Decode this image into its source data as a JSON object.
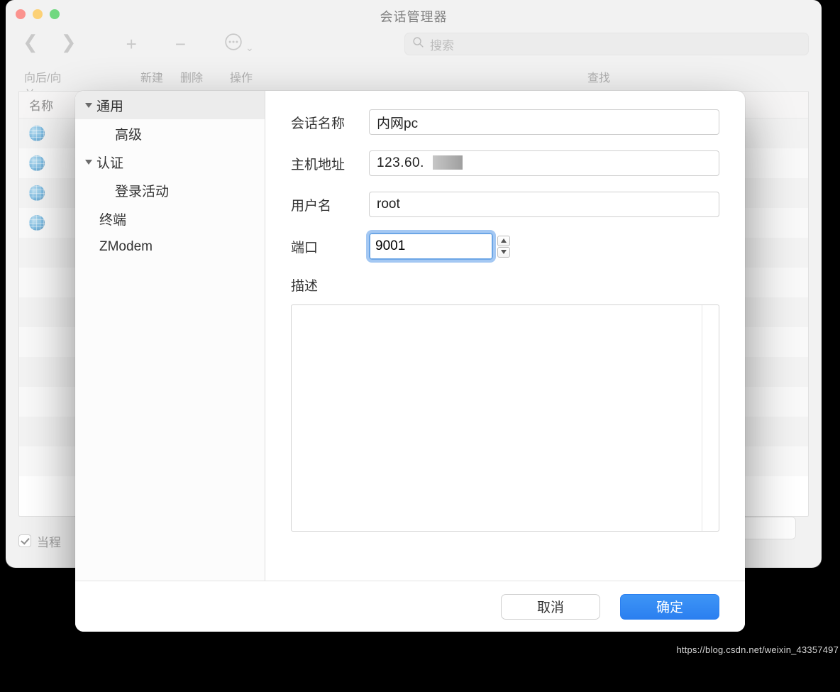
{
  "window": {
    "title": "会话管理器",
    "toolbar": {
      "navLabel": "向后/向前",
      "newLabel": "新建",
      "deleteLabel": "删除",
      "actionLabel": "操作",
      "searchLabel": "查找",
      "searchPlaceholder": "搜索"
    },
    "listHeader": "名称",
    "footerCheckboxLabel": "当程"
  },
  "modal": {
    "sidebar": {
      "general": "通用",
      "advanced": "高级",
      "auth": "认证",
      "loginActivity": "登录活动",
      "terminal": "终端",
      "zmodem": "ZModem"
    },
    "form": {
      "sessionNameLabel": "会话名称",
      "sessionNameValue": "内网pc",
      "hostLabel": "主机地址",
      "hostValue": "123.60.",
      "userLabel": "用户名",
      "userValue": "root",
      "portLabel": "端口",
      "portValue": "9001",
      "descLabel": "描述"
    },
    "buttons": {
      "cancel": "取消",
      "ok": "确定"
    }
  },
  "watermark": "https://blog.csdn.net/weixin_43357497"
}
